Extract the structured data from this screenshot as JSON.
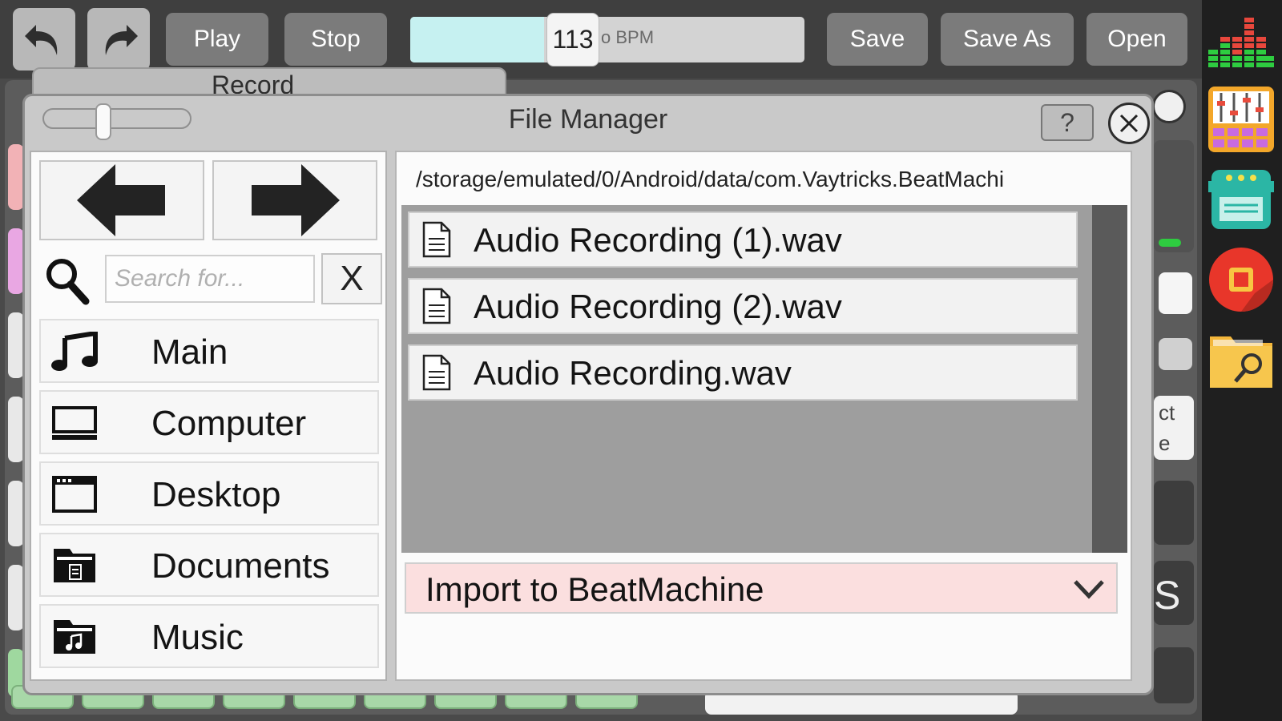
{
  "toolbar": {
    "play_label": "Play",
    "stop_label": "Stop",
    "bpm_value": "113",
    "bpm_unit": "o BPM",
    "bpm_fill_fraction": 0.34,
    "save_label": "Save",
    "save_as_label": "Save As",
    "open_label": "Open"
  },
  "background": {
    "record_title": "Record",
    "card_text_line1": "ct",
    "card_text_line2": "e",
    "card_letter": "S"
  },
  "dialog": {
    "title": "File Manager",
    "help_label": "?",
    "search": {
      "placeholder": "Search for...",
      "value": "",
      "clear_label": "X"
    },
    "places": [
      {
        "label": "Main",
        "icon": "music-note-icon"
      },
      {
        "label": "Computer",
        "icon": "computer-icon"
      },
      {
        "label": "Desktop",
        "icon": "desktop-icon"
      },
      {
        "label": "Documents",
        "icon": "documents-folder-icon"
      },
      {
        "label": "Music",
        "icon": "music-folder-icon"
      }
    ],
    "path": "/storage/emulated/0/Android/data/com.Vaytricks.BeatMachi",
    "files": [
      {
        "name": "Audio Recording (1).wav",
        "icon": "file-icon"
      },
      {
        "name": "Audio Recording (2).wav",
        "icon": "file-icon"
      },
      {
        "name": "Audio Recording.wav",
        "icon": "file-icon"
      }
    ],
    "import_option": "Import to BeatMachine"
  },
  "sidebar": {
    "icons": [
      "equalizer-icon",
      "mixer-icon",
      "sequencer-icon",
      "record-icon",
      "file-browser-icon"
    ]
  },
  "colors": {
    "bpm_fill": "#c6f1f1",
    "import_bg": "#fbdfdf",
    "toolbar_button": "#7b7b7b"
  }
}
